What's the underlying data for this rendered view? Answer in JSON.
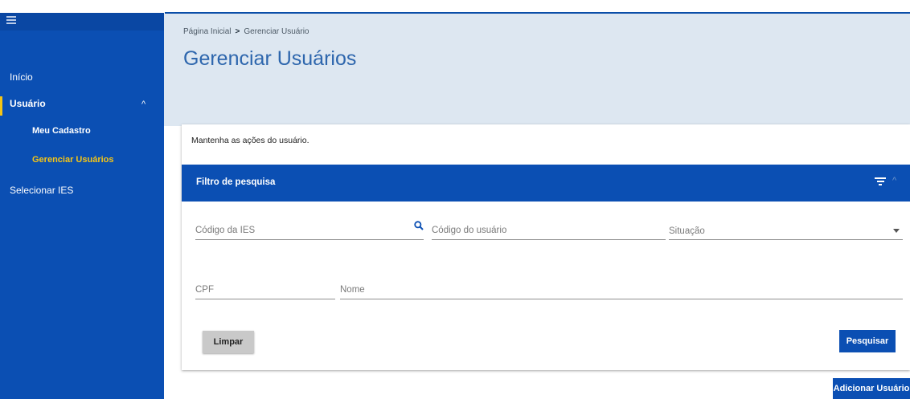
{
  "sidebar": {
    "items": [
      {
        "label": "Início"
      },
      {
        "label": "Usuário"
      },
      {
        "label": "Meu Cadastro"
      },
      {
        "label": "Gerenciar Usuários"
      },
      {
        "label": "Selecionar IES"
      }
    ]
  },
  "header": {
    "breadcrumb": {
      "home": "Página Inicial",
      "separator": ">",
      "current": "Gerenciar Usuário"
    },
    "title": "Gerenciar Usuários"
  },
  "card": {
    "description": "Mantenha as ações do usuário.",
    "filter": {
      "title": "Filtro de pesquisa",
      "fields": {
        "codigo_ies": "Código da IES",
        "codigo_usuario": "Código do usuário",
        "situacao": "Situação",
        "cpf": "CPF",
        "nome": "Nome"
      }
    },
    "buttons": {
      "limpar": "Limpar",
      "pesquisar": "Pesquisar"
    }
  },
  "actions": {
    "adicionar": "Adicionar Usuário"
  },
  "colors": {
    "primary": "#0b4fb3",
    "active": "#f5c516",
    "header_bg": "#dde7f1",
    "title": "#2d66ad"
  }
}
